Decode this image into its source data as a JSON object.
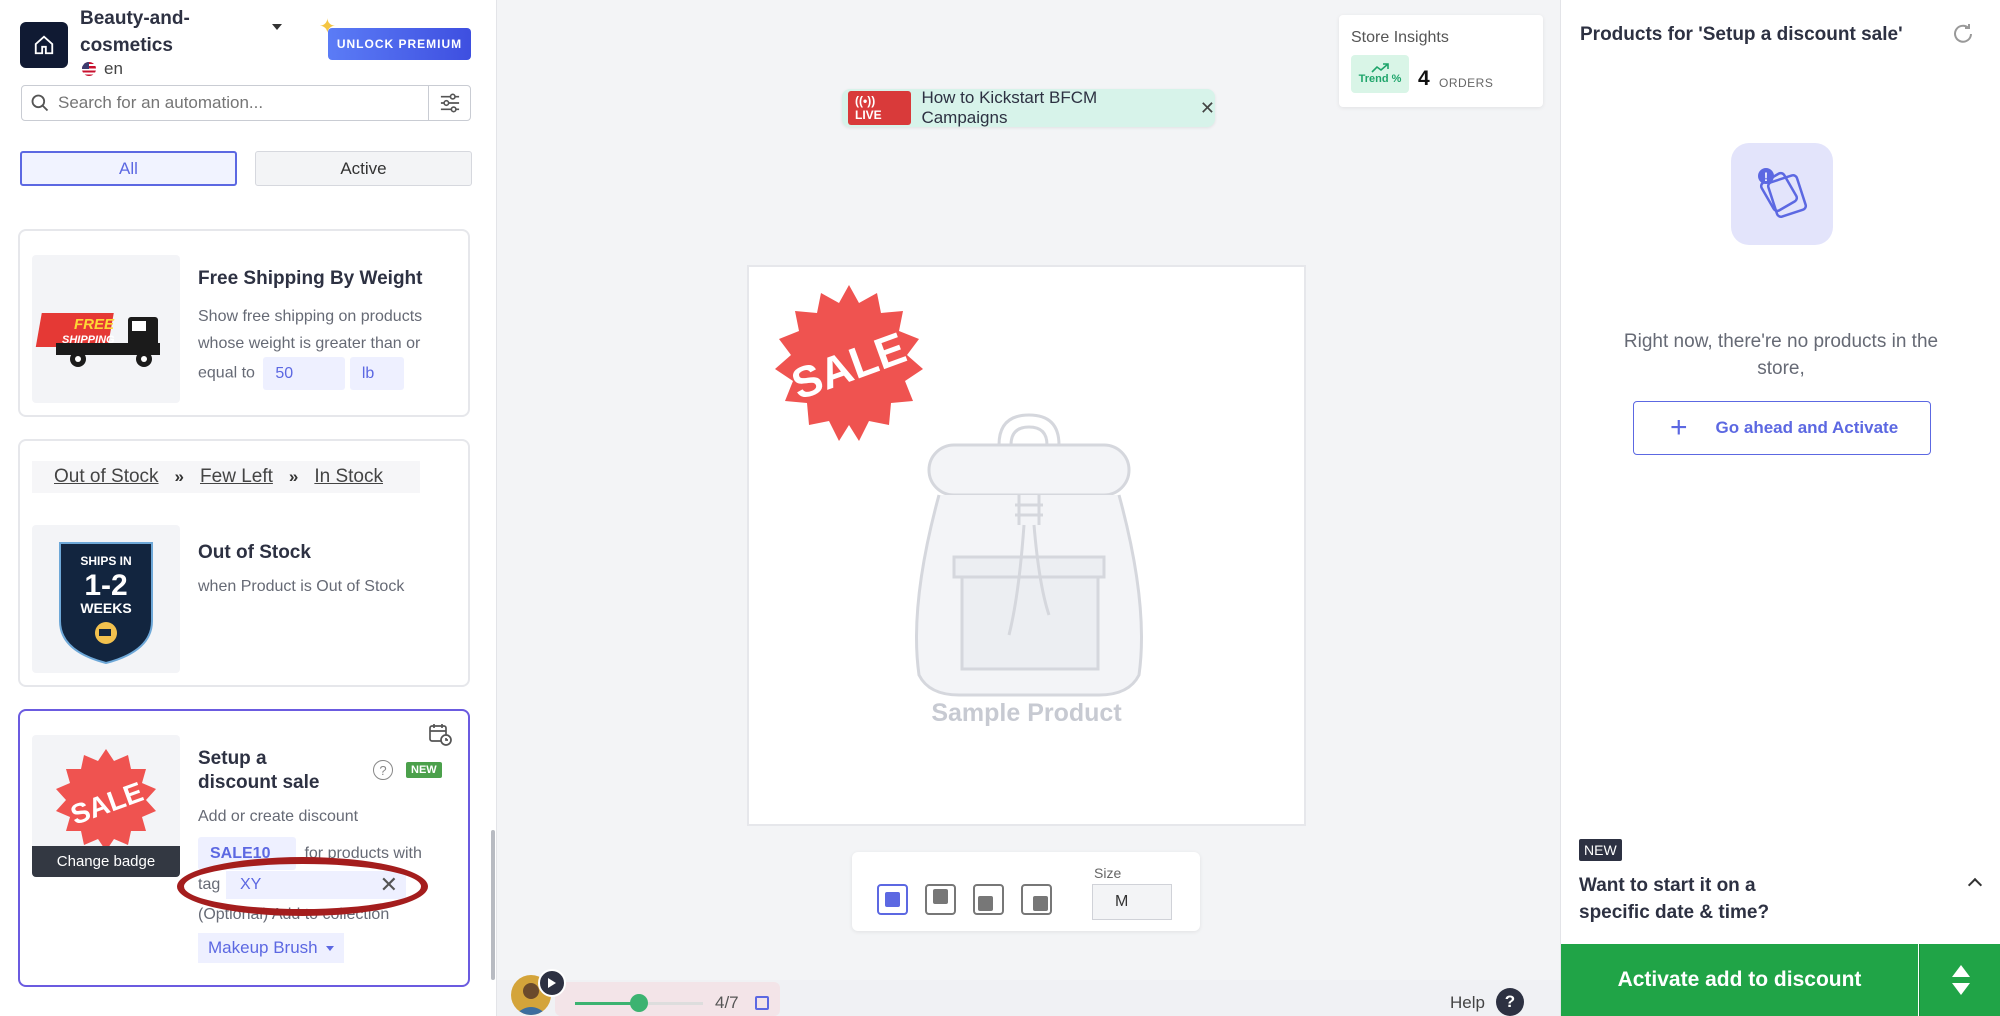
{
  "store": {
    "name": "Beauty-and-cosmetics",
    "language": "en"
  },
  "premium_label": "UNLOCK PREMIUM",
  "search": {
    "placeholder": "Search for an automation..."
  },
  "tabs": [
    {
      "label": "All"
    },
    {
      "label": "Active"
    }
  ],
  "cards": {
    "free_shipping": {
      "title": "Free Shipping By Weight",
      "text": "Show free shipping on products whose weight is greater than or",
      "equal_to": "equal to",
      "value": "50",
      "unit": "lb",
      "badge_text_1": "FREE",
      "badge_text_2": "SHIPPING"
    },
    "stock": {
      "flow": [
        "Out of Stock",
        "Few Left",
        "In Stock"
      ],
      "title": "Out of Stock",
      "text": "when Product is Out of Stock",
      "badge_line1": "SHIPS IN",
      "badge_line2": "1-2",
      "badge_line3": "WEEKS"
    },
    "discount": {
      "title": "Setup a discount sale",
      "new_label": "NEW",
      "text1": "Add or create discount",
      "discount_code": "SALE10",
      "text2": "for products with",
      "tag_prefix": "tag",
      "tag_value": "XY",
      "text3": "(Optional) Add to collection",
      "collection": "Makeup Brush",
      "change_badge": "Change badge",
      "badge_text": "SALE"
    }
  },
  "live": {
    "tag": "LIVE",
    "text": "How to Kickstart BFCM Campaigns"
  },
  "insights": {
    "title": "Store Insights",
    "trend_label": "Trend %",
    "orders_count": "4",
    "orders_label": "ORDERS"
  },
  "preview": {
    "badge_text": "SALE",
    "sample_label": "Sample Product"
  },
  "toolbar": {
    "size_label": "Size",
    "size_value": "M"
  },
  "player": {
    "step": "4/7",
    "progress": 0.5
  },
  "help_label": "Help",
  "right": {
    "title": "Products for 'Setup a discount sale'",
    "empty_text": "Right now, there're no products in the store,",
    "activate_label": "Go ahead and Activate",
    "new_label": "NEW",
    "schedule_question": "Want to start it on a specific date & time?",
    "cta_label": "Activate add to discount"
  },
  "colors": {
    "accent": "#5c68e2",
    "cta_green": "#20a447",
    "sale_red": "#ef5350",
    "live_red": "#d93a3a"
  }
}
